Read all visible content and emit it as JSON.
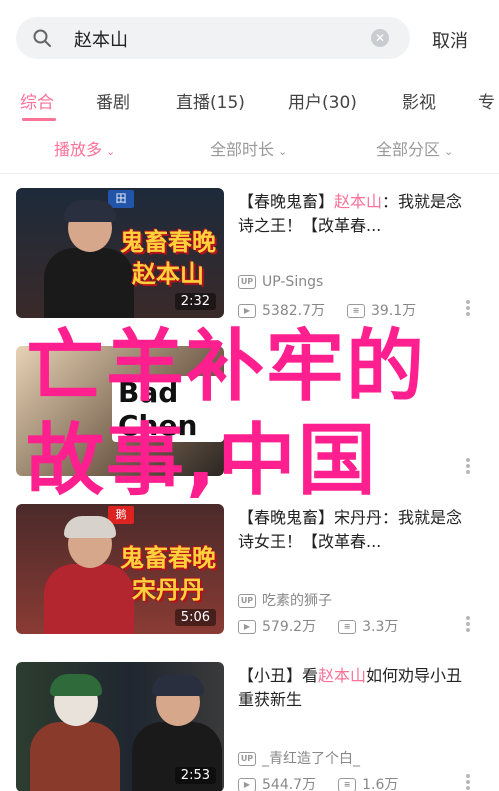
{
  "search": {
    "query": "赵本山",
    "cancel_label": "取消"
  },
  "tabs": [
    "综合",
    "番剧",
    "直播(15)",
    "用户(30)",
    "影视",
    "专"
  ],
  "filters": [
    "播放多",
    "全部时长",
    "全部分区"
  ],
  "results": [
    {
      "title_prefix": "【春晚鬼畜】",
      "title_highlight": "赵本山",
      "title_rest": "：我就是念诗之王！【改革春...",
      "uploader": "UP-Sings",
      "views": "5382.7万",
      "comments": "39.1万",
      "duration": "2:32",
      "overlay_text": "鬼畜春晚赵本山",
      "badge": "田"
    },
    {
      "title_prefix": "",
      "title_highlight": "",
      "title_rest": "",
      "uploader": "",
      "views": "",
      "comments": "",
      "duration": "",
      "overlay_text": "Bad Chen",
      "badge": ""
    },
    {
      "title_prefix": "【春晚鬼畜】",
      "title_highlight": "",
      "title_rest": "宋丹丹：我就是念诗女王！【改革春...",
      "uploader": "吃素的狮子",
      "views": "579.2万",
      "comments": "3.3万",
      "duration": "5:06",
      "overlay_text": "鬼畜春晚宋丹丹",
      "badge": "鹅"
    },
    {
      "title_prefix": "【小丑】",
      "title_highlight": "赵本山",
      "title_rest": "如何劝导小丑重获新生",
      "title_mid": "看",
      "uploader": "_青红造了个白_",
      "views": "544.7万",
      "comments": "1.6万",
      "duration": "2:53",
      "overlay_text": "",
      "badge": ""
    }
  ],
  "watermark": {
    "line1": "亡羊补牢的",
    "line2": "故事,中国"
  },
  "colors": {
    "accent": "#fb7299",
    "watermark": "#ff1f8e"
  }
}
